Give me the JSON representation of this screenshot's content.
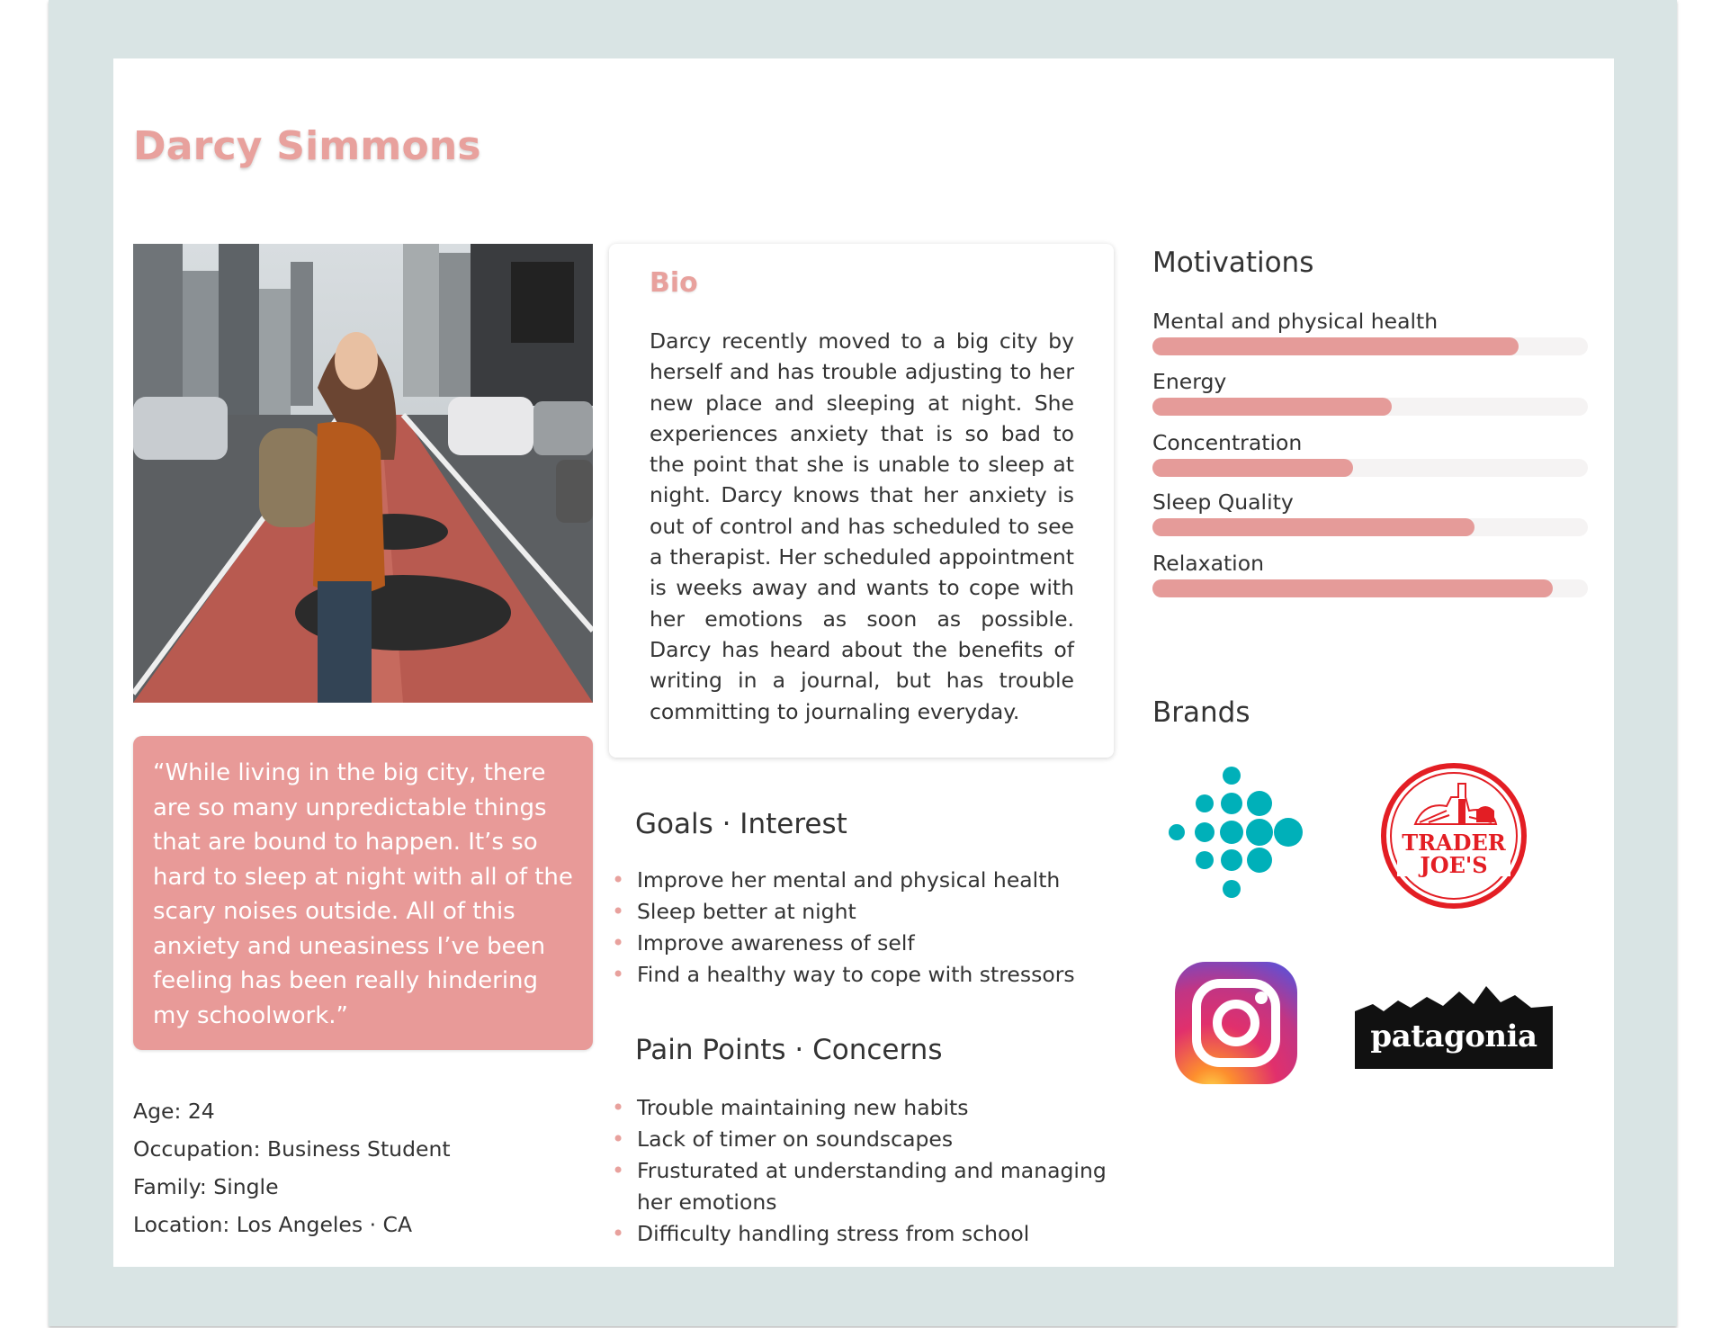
{
  "persona": {
    "name": "Darcy Simmons",
    "photo_alt": "Young woman with a backpack standing in a red city bike lane"
  },
  "quote": "“While living in the big city, there are so many unpredictable things that are bound to happen. It’s so hard to sleep at night with all of the scary noises outside. All of this anxiety and uneasiness I’ve been feeling has been really hindering my schoolwork.”",
  "facts": [
    "Age: 24",
    "Occupation: Business Student",
    "Family: Single",
    "Location: Los Angeles · CA"
  ],
  "bio": {
    "title": "Bio",
    "text": "Darcy recently moved to a big city by herself and has trouble adjusting to her new place and sleeping at night. She experiences anxiety that is so bad to the point that she is unable to sleep at night. Darcy knows that her anxiety is out of control and has scheduled to see a therapist. Her scheduled appointment is weeks away and wants to cope with her emotions as soon as possible. Darcy has heard about the benefits of writing in a journal, but has trouble committing to journaling everyday."
  },
  "goals": {
    "title": "Goals · Interest",
    "items": [
      "Improve her mental and physical health",
      "Sleep better at night",
      "Improve awareness of self",
      "Find a healthy way to cope with stressors"
    ]
  },
  "pain_points": {
    "title": "Pain Points · Concerns",
    "items": [
      "Trouble maintaining new habits",
      "Lack of timer on soundscapes",
      "Frusturated at understanding and managing her emotions",
      "Difficulty handling stress from school"
    ]
  },
  "motivations": {
    "title": "Motivations",
    "items": [
      {
        "label": "Mental and physical health",
        "level": 0.84
      },
      {
        "label": "Energy",
        "level": 0.55
      },
      {
        "label": "Concentration",
        "level": 0.46
      },
      {
        "label": "Sleep Quality",
        "level": 0.74
      },
      {
        "label": "Relaxation",
        "level": 0.92
      }
    ]
  },
  "brands": {
    "title": "Brands",
    "trader_joes": {
      "line1": "TRADER",
      "line2": "JOE'S"
    },
    "patagonia": "patagonia",
    "icons": [
      "fitbit-logo-icon",
      "trader-joes-logo-icon",
      "instagram-logo-icon",
      "patagonia-logo-icon"
    ]
  },
  "colors": {
    "accent": "#e8a19d",
    "bar": "#e59b99",
    "frame": "#d9e4e4",
    "fitbit": "#00b0b9",
    "trader_joes": "#e31e24"
  }
}
